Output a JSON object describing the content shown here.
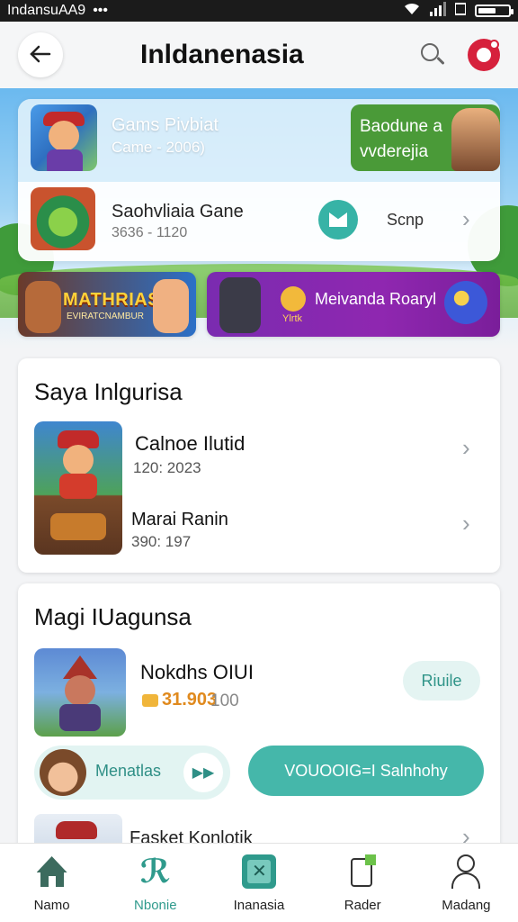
{
  "status_bar": {
    "carrier": "IndansuAA9",
    "dots": "•••",
    "battery_level": 0.6
  },
  "header": {
    "title": "Inldanenasia"
  },
  "promo": {
    "row1": {
      "title": "Gams Pivbiat",
      "subtitle": "Came - 2006)",
      "badge_line1": "Baodune a",
      "badge_line2": "vvderejia"
    },
    "row2": {
      "title": "Saohvliaia Gane",
      "meta": "3636 - 1120",
      "action": "Scnp"
    }
  },
  "banners": {
    "left": {
      "logo": "MATHRIAS",
      "sub": "EVIRATCNAMBUR"
    },
    "right": {
      "title": "Meivanda Roaryl",
      "small": "Ylrtk"
    }
  },
  "section1": {
    "title": "Saya Inlgurisa",
    "items": [
      {
        "name": "Calnoe Ilutid",
        "meta": "120: 2023"
      },
      {
        "name": "Marai Ranin",
        "meta": "390: 197"
      }
    ]
  },
  "section2": {
    "title": "Magi IUagunsa",
    "game": {
      "name": "Nokdhs OIUI",
      "price": "31.903",
      "old_price": "100",
      "button": "Riuile"
    },
    "pill_light": {
      "label": "Menatlas",
      "play": "▶▶"
    },
    "pill_teal": "VOUOOIG=I Salnhohy",
    "peek": {
      "name": "Fasket Konlotik"
    }
  },
  "bottom_nav": [
    {
      "label": "Namo",
      "icon": "home-icon"
    },
    {
      "label": "Nbonie",
      "icon": "shop-icon"
    },
    {
      "label": "Inanasia",
      "icon": "category-icon"
    },
    {
      "label": "Rader",
      "icon": "reader-icon"
    },
    {
      "label": "Madang",
      "icon": "user-icon"
    }
  ],
  "colors": {
    "accent": "#2f9a8c",
    "teal": "#45b7aa",
    "notification": "#d6213c",
    "promo_green": "#4a9a38"
  }
}
